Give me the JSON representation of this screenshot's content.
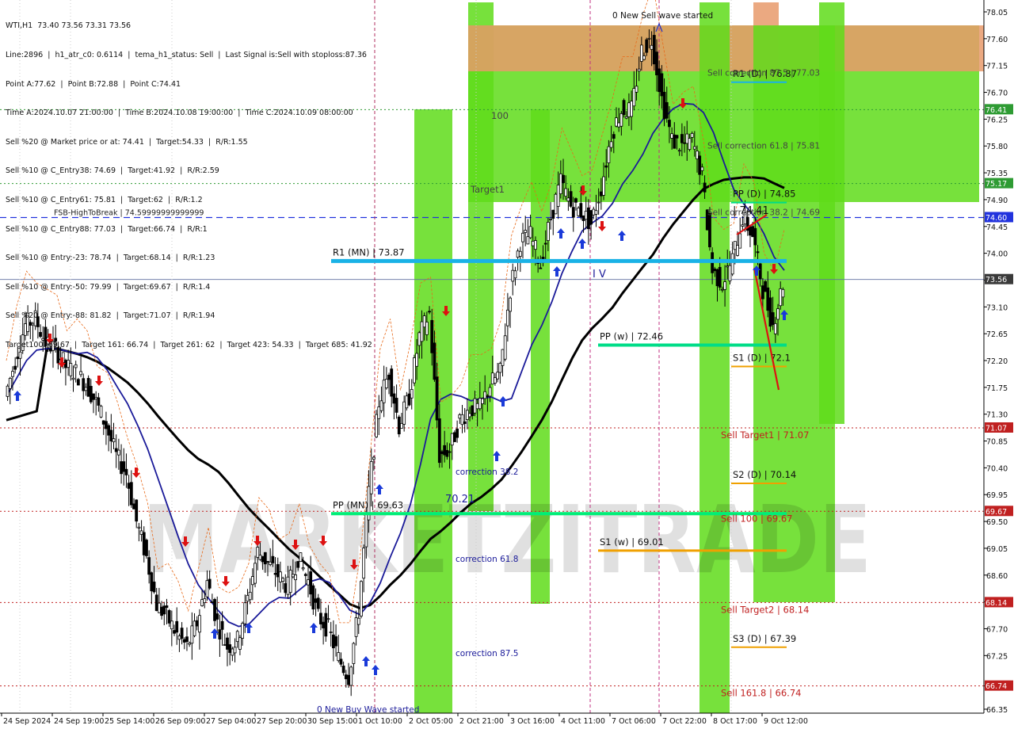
{
  "header": {
    "lines": [
      "WTI,H1  73.40 73.56 73.31 73.56",
      "Line:2896  |  h1_atr_c0: 0.6114  |  tema_h1_status: Sell  |  Last Signal is:Sell with stoploss:87.36",
      "Point A:77.62  |  Point B:72.88  |  Point C:74.41",
      "Time A:2024.10.07 21:00:00  |  Time B:2024.10.08 19:00:00  |  Time C:2024.10.09 08:00:00",
      "Sell %20 @ Market price or at: 74.41  |  Target:54.33  |  R/R:1.55",
      "Sell %10 @ C_Entry38: 74.69  |  Target:41.92  |  R/R:2.59",
      "Sell %10 @ C_Entry61: 75.81  |  Target:62  |  R/R:1.2",
      "Sell %10 @ C_Entry88: 77.03  |  Target:66.74  |  R/R:1",
      "Sell %10 @ Entry:-23: 78.74  |  Target:68.14  |  R/R:1.23",
      "Sell %10 @ Entry:-50: 79.99  |  Target:69.67  |  R/R:1.4",
      "Sell %20 @ Entry:-88: 81.82  |  Target:71.07  |  R/R:1.94",
      "Target100: 69.67  |  Target 161: 66.74  |  Target 261: 62  |  Target 423: 54.33  |  Target 685: 41.92"
    ]
  },
  "chart_data": {
    "type": "candlestick",
    "symbol": "WTI,H1",
    "ohlc_last": {
      "open": 73.4,
      "high": 73.56,
      "low": 73.31,
      "close": 73.56
    },
    "ylim": [
      66.35,
      78.05
    ],
    "y_ticks": [
      66.35,
      66.74,
      67.25,
      67.7,
      68.15,
      68.6,
      69.05,
      69.5,
      69.95,
      70.4,
      70.85,
      71.3,
      71.75,
      72.2,
      72.65,
      73.1,
      73.55,
      74.0,
      74.45,
      74.9,
      75.35,
      75.8,
      76.25,
      76.7,
      77.15,
      77.6,
      78.05
    ],
    "x_ticks": [
      "24 Sep 2024",
      "24 Sep 19:00",
      "25 Sep 14:00",
      "26 Sep 09:00",
      "27 Sep 04:00",
      "27 Sep 20:00",
      "30 Sep 15:00",
      "1 Oct 10:00",
      "2 Oct 05:00",
      "2 Oct 21:00",
      "3 Oct 16:00",
      "4 Oct 11:00",
      "7 Oct 06:00",
      "7 Oct 22:00",
      "8 Oct 17:00",
      "9 Oct 12:00"
    ],
    "price_path": [
      71.6,
      72.2,
      72.8,
      72.9,
      72.5,
      72.4,
      72.1,
      72.0,
      71.8,
      71.5,
      71.1,
      70.6,
      70.3,
      69.5,
      68.9,
      68.1,
      67.9,
      67.6,
      67.4,
      67.8,
      68.5,
      67.8,
      67.4,
      67.5,
      68.2,
      69.0,
      68.8,
      68.6,
      68.4,
      68.9,
      68.5,
      67.9,
      67.7,
      67.2,
      66.9,
      68.0,
      70.0,
      71.5,
      72.0,
      71.1,
      71.6,
      72.6,
      73.0,
      70.6,
      70.7,
      71.2,
      71.4,
      71.4,
      71.8,
      72.0,
      73.4,
      74.2,
      74.3,
      73.8,
      74.6,
      75.2,
      74.8,
      74.7,
      74.5,
      75.1,
      76.0,
      76.4,
      76.4,
      77.4,
      77.6,
      76.6,
      75.9,
      75.8,
      75.9,
      75.3,
      73.7,
      73.5,
      73.9,
      74.6,
      74.3,
      73.4,
      72.8,
      73.5
    ],
    "levels": [
      {
        "label": "R1 (MN) | 73.87",
        "value": 73.87,
        "color": "#1ab2e6"
      },
      {
        "label": "PP (w) | 72.46",
        "value": 72.46,
        "color": "#00dd88"
      },
      {
        "label": "PP (MN) | 69.63",
        "value": 69.63,
        "color": "#00ee77"
      },
      {
        "label": "S1 (w) | 69.01",
        "value": 69.01,
        "color": "#f0a000"
      },
      {
        "label": "PP (D) | 74.85",
        "value": 74.85,
        "color": "#00dd88"
      },
      {
        "label": "S1 (D) | 72.1",
        "value": 72.1,
        "color": "#f0a000"
      },
      {
        "label": "S2 (D) | 70.14",
        "value": 70.14,
        "color": "#f0a000"
      },
      {
        "label": "S3 (D) | 67.39",
        "value": 67.39,
        "color": "#f0a000"
      },
      {
        "label": "R1 (D) | 76.87",
        "value": 76.87,
        "color": "#1ab2e6"
      }
    ],
    "targets": [
      {
        "label": "Sell Target1 | 71.07",
        "value": 71.07
      },
      {
        "label": "Sell 100 | 69.67",
        "value": 69.67
      },
      {
        "label": "Sell Target2 | 68.14",
        "value": 68.14
      },
      {
        "label": "Sell 161.8 | 66.74",
        "value": 66.74
      }
    ],
    "annotations": [
      {
        "text": "0 New Sell wave started"
      },
      {
        "text": "0 New Buy Wave started"
      },
      {
        "text": "Target1"
      },
      {
        "text": "100"
      },
      {
        "text": "correction 38.2"
      },
      {
        "text": "correction 61.8"
      },
      {
        "text": "correction 87.5"
      },
      {
        "text": "Sell correction 87.5 | 77.03"
      },
      {
        "text": "Sell correction 61.8 | 75.81"
      },
      {
        "text": "Sell correction 38.2 | 74.69"
      },
      {
        "text": "FSB-HighToBreak | 74.59999999999999"
      },
      {
        "text": "| 74.41"
      },
      {
        "text": "70.21"
      },
      {
        "text": "I V"
      }
    ],
    "badges": [
      {
        "value": "76.41",
        "color": "#2e9b33"
      },
      {
        "value": "75.17",
        "color": "#2e9b33"
      },
      {
        "value": "74.60",
        "color": "#2233dd"
      },
      {
        "value": "73.56",
        "color": "#3a3a3a"
      },
      {
        "value": "71.07",
        "color": "#c02020"
      },
      {
        "value": "69.67",
        "color": "#c02020"
      },
      {
        "value": "68.14",
        "color": "#c02020"
      },
      {
        "value": "66.74",
        "color": "#c02020"
      }
    ],
    "watermark": "MARKETZITRADE",
    "grid": false
  }
}
